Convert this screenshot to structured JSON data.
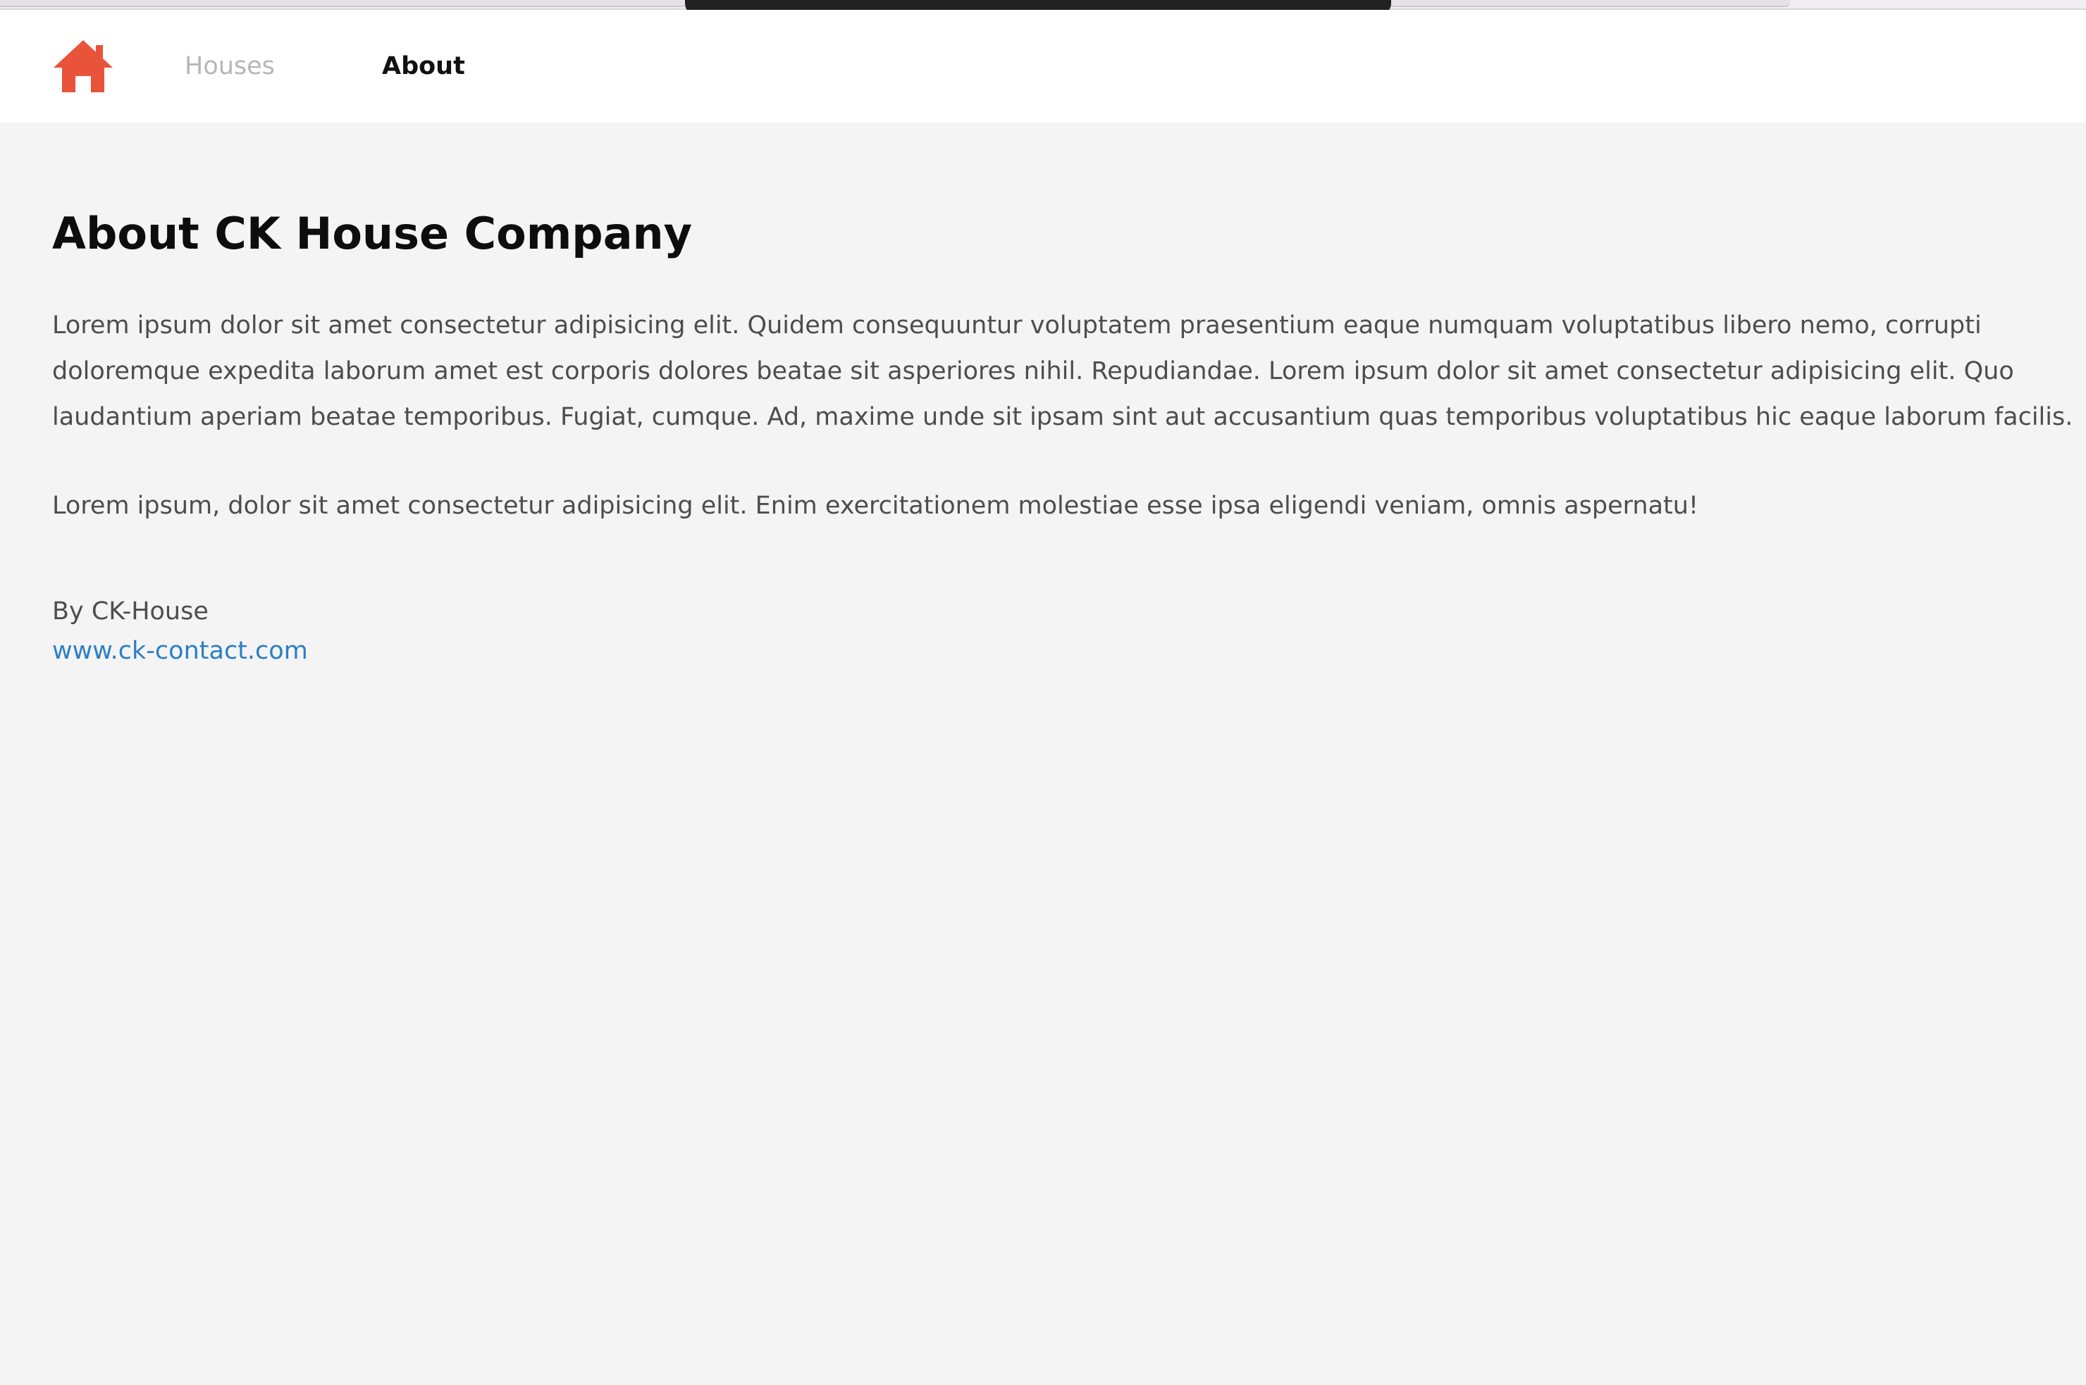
{
  "theme": {
    "accent": "#e8533a",
    "link": "#2b7fc4",
    "nav_inactive": "#b6b6b6",
    "nav_active": "#111111",
    "page_background": "#f4f4f4",
    "navbar_background": "#ffffff"
  },
  "navbar": {
    "home_icon": "home-icon",
    "links": [
      {
        "label": "Houses",
        "active": false
      },
      {
        "label": "About",
        "active": true
      }
    ]
  },
  "main": {
    "title": "About CK House Company",
    "paragraph_1_lines": [
      "Lorem ipsum dolor sit amet consectetur adipisicing elit. Quidem consequuntur voluptatem praesentium eaque numquam voluptatibus libero nemo, corrupti",
      "doloremque expedita laborum amet est corporis dolores beatae sit asperiores nihil. Repudiandae. Lorem ipsum dolor sit amet consectetur adipisicing elit. Quo",
      "laudantium aperiam beatae temporibus. Fugiat, cumque. Ad, maxime unde sit ipsam sint aut accusantium quas temporibus voluptatibus hic eaque laborum facilis."
    ],
    "paragraph_2": "Lorem ipsum, dolor sit amet consectetur adipisicing elit. Enim exercitationem molestiae esse ipsa eligendi veniam, omnis aspernatu!",
    "byline": "By CK-House",
    "contact_link": "www.ck-contact.com"
  }
}
